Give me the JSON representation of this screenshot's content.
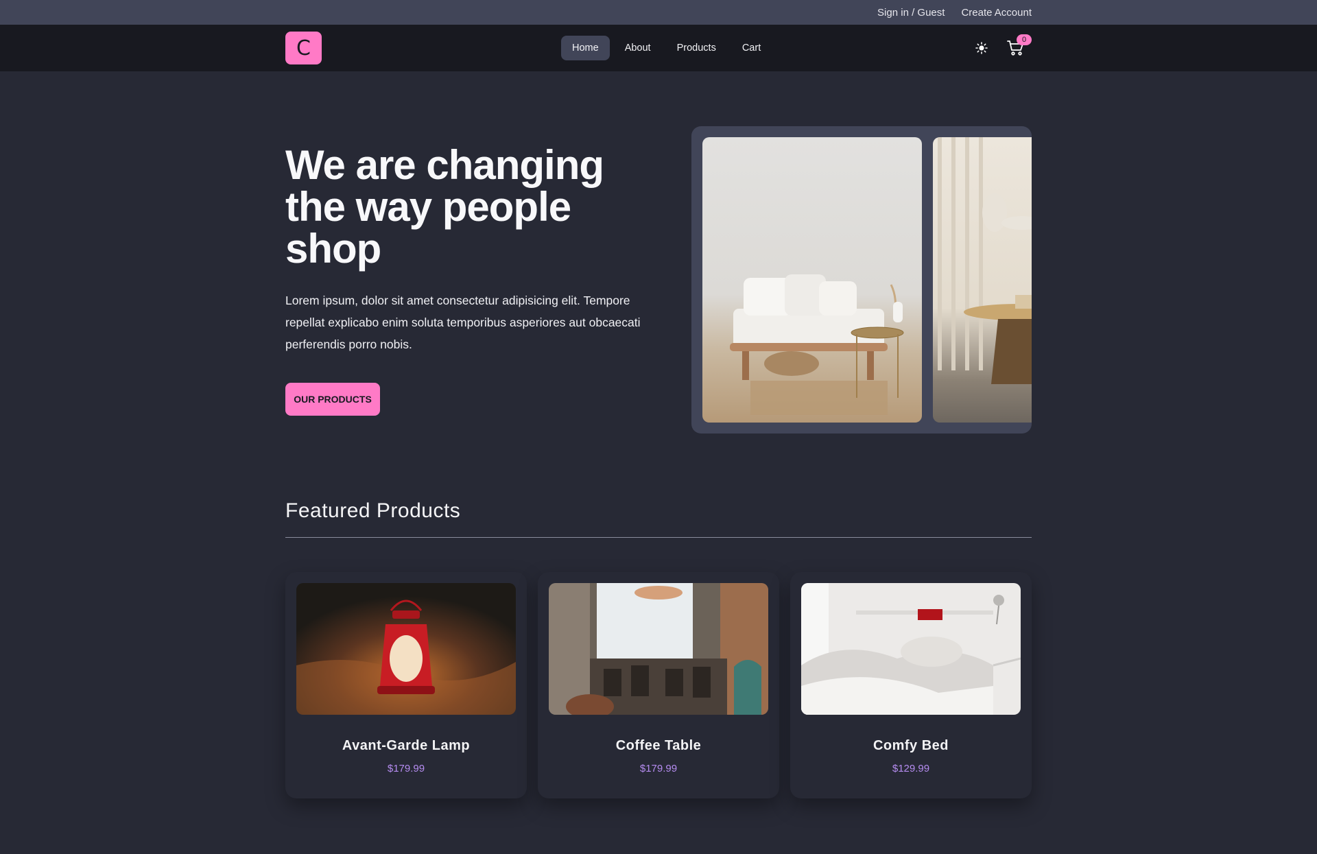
{
  "topbar": {
    "sign_in": "Sign in / Guest",
    "create_account": "Create Account"
  },
  "navbar": {
    "logo_letter": "C",
    "links": [
      {
        "label": "Home",
        "active": true
      },
      {
        "label": "About",
        "active": false
      },
      {
        "label": "Products",
        "active": false
      },
      {
        "label": "Cart",
        "active": false
      }
    ],
    "cart_count": "0",
    "icons": [
      "sun-icon",
      "cart-icon"
    ]
  },
  "hero": {
    "title": "We are changing the way people shop",
    "text": "Lorem ipsum, dolor sit amet consectetur adipisicing elit. Tempore repellat explicabo enim soluta temporibus asperiores aut obcaecati perferendis porro nobis.",
    "cta": "OUR PRODUCTS"
  },
  "featured": {
    "title": "Featured Products",
    "products": [
      {
        "name": "Avant-Garde Lamp",
        "price": "$179.99"
      },
      {
        "name": "Coffee Table",
        "price": "$179.99"
      },
      {
        "name": "Comfy Bed",
        "price": "$129.99"
      }
    ]
  },
  "colors": {
    "accent": "#ff7ac6",
    "price": "#b58cf0",
    "bg": "#272935",
    "nav": "#181920",
    "topbar": "#414558"
  }
}
